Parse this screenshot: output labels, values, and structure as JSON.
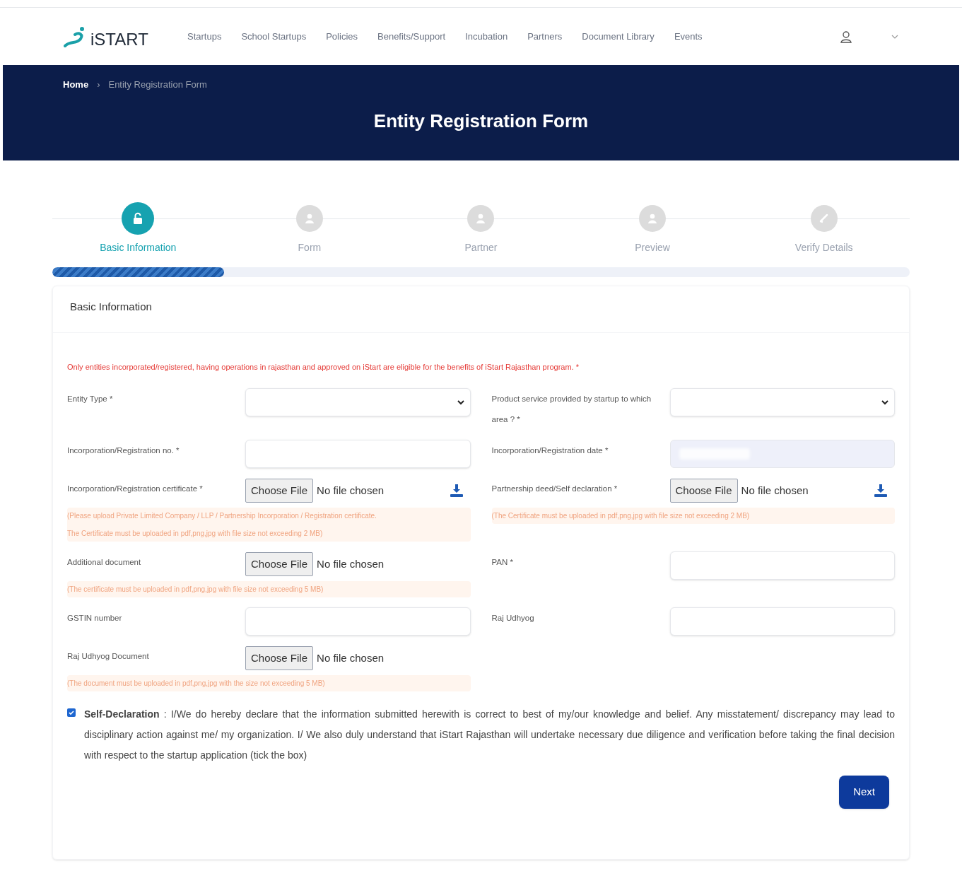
{
  "header": {
    "logo": "iSTART",
    "nav": [
      "Startups",
      "School Startups",
      "Policies",
      "Benefits/Support",
      "Incubation",
      "Partners",
      "Document Library",
      "Events"
    ]
  },
  "banner": {
    "separator": "›",
    "breadcrumb": [
      {
        "label": "Home",
        "current": false
      },
      {
        "label": "Entity Registration Form",
        "current": true
      }
    ],
    "title": "Entity Registration Form"
  },
  "steps": [
    {
      "label": "Basic Information",
      "kind": "lock",
      "selected": true
    },
    {
      "label": "Form",
      "kind": "user",
      "selected": false
    },
    {
      "label": "Partner",
      "kind": "user",
      "selected": false
    },
    {
      "label": "Preview",
      "kind": "user",
      "selected": false
    },
    {
      "label": "Verify Details",
      "kind": "check",
      "selected": false
    }
  ],
  "progress": {
    "level": 0.2
  },
  "card": {
    "title": "Basic Information",
    "notice": "Only entities incorporated/registered, having operations in rajasthan and approved on iStart are eligible for the benefits of iStart Rajasthan program. *",
    "rows": [
      [
        {
          "kind": "select",
          "label": "Entity Type *"
        },
        {
          "kind": "select",
          "label": "Product service provided by startup to which area ? *"
        }
      ],
      [
        {
          "kind": "text",
          "label": "Incorporation/Registration no. *"
        },
        {
          "kind": "date",
          "label": "Incorporation/Registration date *"
        }
      ],
      [
        {
          "kind": "file",
          "label": "Incorporation/Registration certificate *",
          "button": "Choose File",
          "status": "No file chosen",
          "download": true,
          "notes": [
            "(Please upload Private Limited Company / LLP / Partnership Incorporation / Registration certificate.",
            "The Certificate must be uploaded in pdf,png,jpg with file size not exceeding 2 MB)"
          ]
        },
        {
          "kind": "file",
          "label": "Partnership deed/Self declaration *",
          "button": "Choose File",
          "status": "No file chosen",
          "download": true,
          "notes": [
            "(The Certificate must be uploaded in pdf,png,jpg with file size not exceeding 2 MB)"
          ]
        }
      ],
      [
        {
          "kind": "file",
          "label": "Additional document",
          "button": "Choose File",
          "status": "No file chosen",
          "download": false,
          "notes": [
            "(The certificate must be uploaded in pdf,png,jpg with file size not exceeding 5 MB)"
          ]
        },
        {
          "kind": "text",
          "label": "PAN *"
        }
      ],
      [
        {
          "kind": "text",
          "label": "GSTIN number"
        },
        {
          "kind": "text",
          "label": "Raj Udhyog"
        }
      ],
      [
        {
          "kind": "file",
          "label": "Raj Udhyog Document",
          "button": "Choose File",
          "status": "No file chosen",
          "download": false,
          "notes": [
            "(The document must be uploaded in pdf,png,jpg with the size not exceeding 5 MB)"
          ]
        }
      ]
    ],
    "declaration": {
      "checked": true,
      "text": "**Self-Declaration** : I/We do hereby declare that the information submitted herewith is correct to best of my/our knowledge and belief. Any misstatement/ discrepancy may lead to disciplinary action against me/ my organization. I/ We also duly understand that iStart Rajasthan will undertake necessary due diligence and verification before taking the final decision with respect to the startup application (tick the box)"
    },
    "next": "Next"
  }
}
